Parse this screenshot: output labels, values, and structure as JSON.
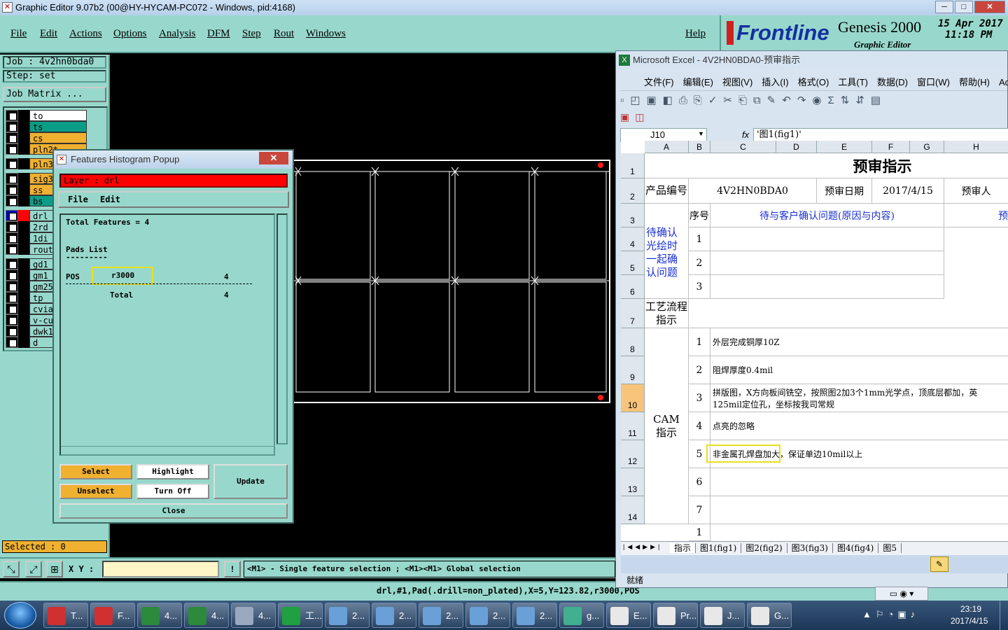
{
  "window": {
    "title": "Graphic Editor 9.07b2 (00@HY-HYCAM-PC072 - Windows, pid:4168)",
    "min": "─",
    "max": "□",
    "close": "✕"
  },
  "menu": {
    "file": "File",
    "edit": "Edit",
    "actions": "Actions",
    "options": "Options",
    "analysis": "Analysis",
    "dfm": "DFM",
    "step": "Step",
    "rout": "Rout",
    "windows": "Windows",
    "help": "Help"
  },
  "brand": {
    "logo": "Frontline",
    "product": "Genesis 2000",
    "subtitle": "Graphic Editor",
    "date": "15 Apr 2017",
    "time": "11:18 PM"
  },
  "left": {
    "job": "Job : 4v2hn0bda0",
    "step": "Step: set",
    "job_matrix": "Job Matrix ...",
    "selected": "Selected : 0",
    "layers": [
      {
        "name": "to",
        "color": "#ffffff",
        "sw": "#000000"
      },
      {
        "name": "ts",
        "color": "#0a9e88",
        "sw": "#000000"
      },
      {
        "name": "cs",
        "color": "#f0b030",
        "sw": "#000000"
      },
      {
        "name": "pln2t",
        "color": "#f0b030",
        "sw": "#000000"
      },
      {
        "name": "pln3b",
        "color": "#f0b030",
        "sw": "#000000"
      },
      {
        "name": "sig3b",
        "color": "#f0b030",
        "sw": "#000000"
      },
      {
        "name": "ss",
        "color": "#f0b030",
        "sw": "#000000"
      },
      {
        "name": "bs",
        "color": "#0a9e88",
        "sw": "#000000"
      },
      {
        "name": "drl",
        "color": "#98d8cc",
        "sw": "#ff0000"
      },
      {
        "name": "2rd",
        "color": "#98d8cc",
        "sw": "#000000"
      },
      {
        "name": "1di",
        "color": "#98d8cc",
        "sw": "#000000"
      },
      {
        "name": "rout",
        "color": "#98d8cc",
        "sw": "#000000"
      },
      {
        "name": "gd1",
        "color": "#98d8cc",
        "sw": "#000000"
      },
      {
        "name": "gm1",
        "color": "#98d8cc",
        "sw": "#000000"
      },
      {
        "name": "gm25",
        "color": "#98d8cc",
        "sw": "#000000"
      },
      {
        "name": "tp",
        "color": "#98d8cc",
        "sw": "#000000"
      },
      {
        "name": "cvia",
        "color": "#98d8cc",
        "sw": "#000000"
      },
      {
        "name": "v-cut",
        "color": "#98d8cc",
        "sw": "#000000"
      },
      {
        "name": "dwk1",
        "color": "#98d8cc",
        "sw": "#000000"
      },
      {
        "name": "d",
        "color": "#98d8cc",
        "sw": "#000000"
      }
    ]
  },
  "popup": {
    "title": "Features Histogram Popup",
    "layer": "Layer :  drl",
    "menu_file": "File",
    "menu_edit": "Edit",
    "total": "Total Features = 4",
    "pads_list": "Pads List",
    "dashes": "---------",
    "row_label": "POS",
    "row_sym": "r3000",
    "row_count": "4",
    "total_label": "Total",
    "total_count": "4",
    "select": "Select",
    "highlight": "Highlight",
    "update": "Update",
    "unselect": "Unselect",
    "turn_off": "Turn Off",
    "close": "Close"
  },
  "bottom": {
    "xy_label": "X Y :",
    "xy_value": "",
    "hint": "<M1> - Single feature selection ; <M1><M1> Global selection",
    "status": "drl,#1,Pad(.drill=non_plated),X=5,Y=123.82,r3000,POS"
  },
  "excel": {
    "title": "Microsoft Excel - 4V2HN0BDA0-预审指示",
    "menu": [
      "文件(F)",
      "编辑(E)",
      "视图(V)",
      "插入(I)",
      "格式(O)",
      "工具(T)",
      "数据(D)",
      "窗口(W)",
      "帮助(H)",
      "Ad"
    ],
    "namebox": "J10",
    "fx": "fx",
    "formula": "'图1(fig1)'",
    "cols": [
      "A",
      "B",
      "C",
      "D",
      "E",
      "F",
      "G",
      "H"
    ],
    "rows": [
      "1",
      "2",
      "3",
      "4",
      "5",
      "6",
      "7",
      "8",
      "9",
      "10",
      "11",
      "12",
      "13",
      "14"
    ],
    "sheet_title": "预审指示",
    "product_label": "产品编号",
    "product_no": "4V2HN0BDA0",
    "date_label": "预审日期",
    "date_value": "2017/4/15",
    "reviewer_label": "预审人",
    "seq_label": "序号",
    "issue_header": "待与客户确认问题(原因与内容)",
    "issue_header2": "预",
    "confirm_label": "待确认光绘时一起确认问题",
    "process_label": "工艺流程指示",
    "cam_label": "CAM指示",
    "items": [
      "外层完成铜厚10Z",
      "阻焊厚度0.4mil",
      "拼版图，X方向板间铣空，按照图2加3个1mm光学点，顶底层都加，英",
      "125mil定位孔，坐标按我司常规",
      "点亮的忽略",
      "非金属孔焊盘加大，保证单边10mil以上"
    ],
    "nums": [
      "1",
      "2",
      "3",
      "1",
      "2",
      "3",
      "4",
      "5",
      "6",
      "7",
      "1"
    ],
    "tabs": [
      "指示",
      "图1(fig1)",
      "图2(fig2)",
      "图3(fig3)",
      "图4(fig4)",
      "图5"
    ],
    "status": "就绪"
  },
  "taskbar": {
    "items": [
      "T...",
      "F...",
      "4...",
      "4...",
      "4...",
      "工...",
      "2...",
      "2...",
      "2...",
      "2...",
      "2...",
      "g...",
      "E...",
      "Pr...",
      "J...",
      "G..."
    ],
    "time": "23:19",
    "date": "2017/4/15"
  }
}
